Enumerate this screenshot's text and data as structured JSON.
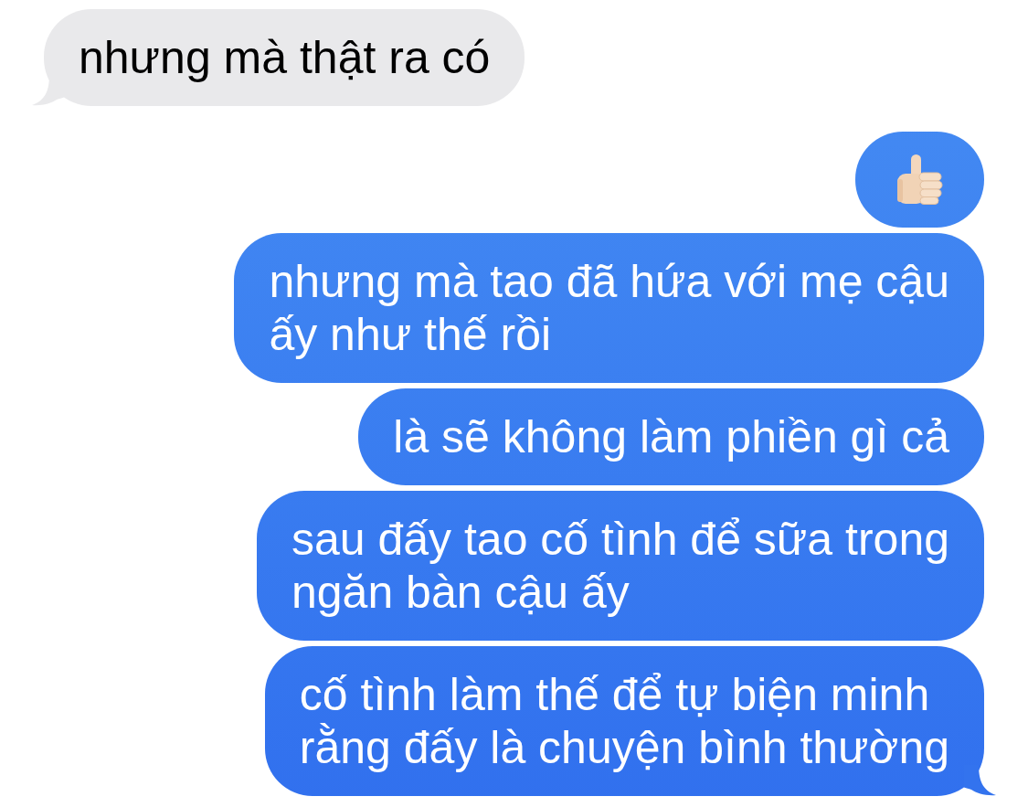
{
  "messages": [
    {
      "outgoing": false,
      "kind": "text",
      "text": "nhưng mà thật ra có",
      "tail": true
    },
    {
      "outgoing": true,
      "kind": "emoji",
      "tail": false
    },
    {
      "outgoing": true,
      "kind": "text",
      "text": "nhưng mà tao đã hứa với mẹ cậu\nấy như thế rồi",
      "tail": false
    },
    {
      "outgoing": true,
      "kind": "text",
      "text": "là sẽ không làm phiền gì cả",
      "tail": false
    },
    {
      "outgoing": true,
      "kind": "text",
      "text": "sau đấy tao cố tình để sữa trong\nngăn bàn cậu ấy",
      "tail": false
    },
    {
      "outgoing": true,
      "kind": "text",
      "text": "cố tình làm thế để tự biện minh\nrằng đấy là chuyện bình thường",
      "tail": true
    }
  ]
}
